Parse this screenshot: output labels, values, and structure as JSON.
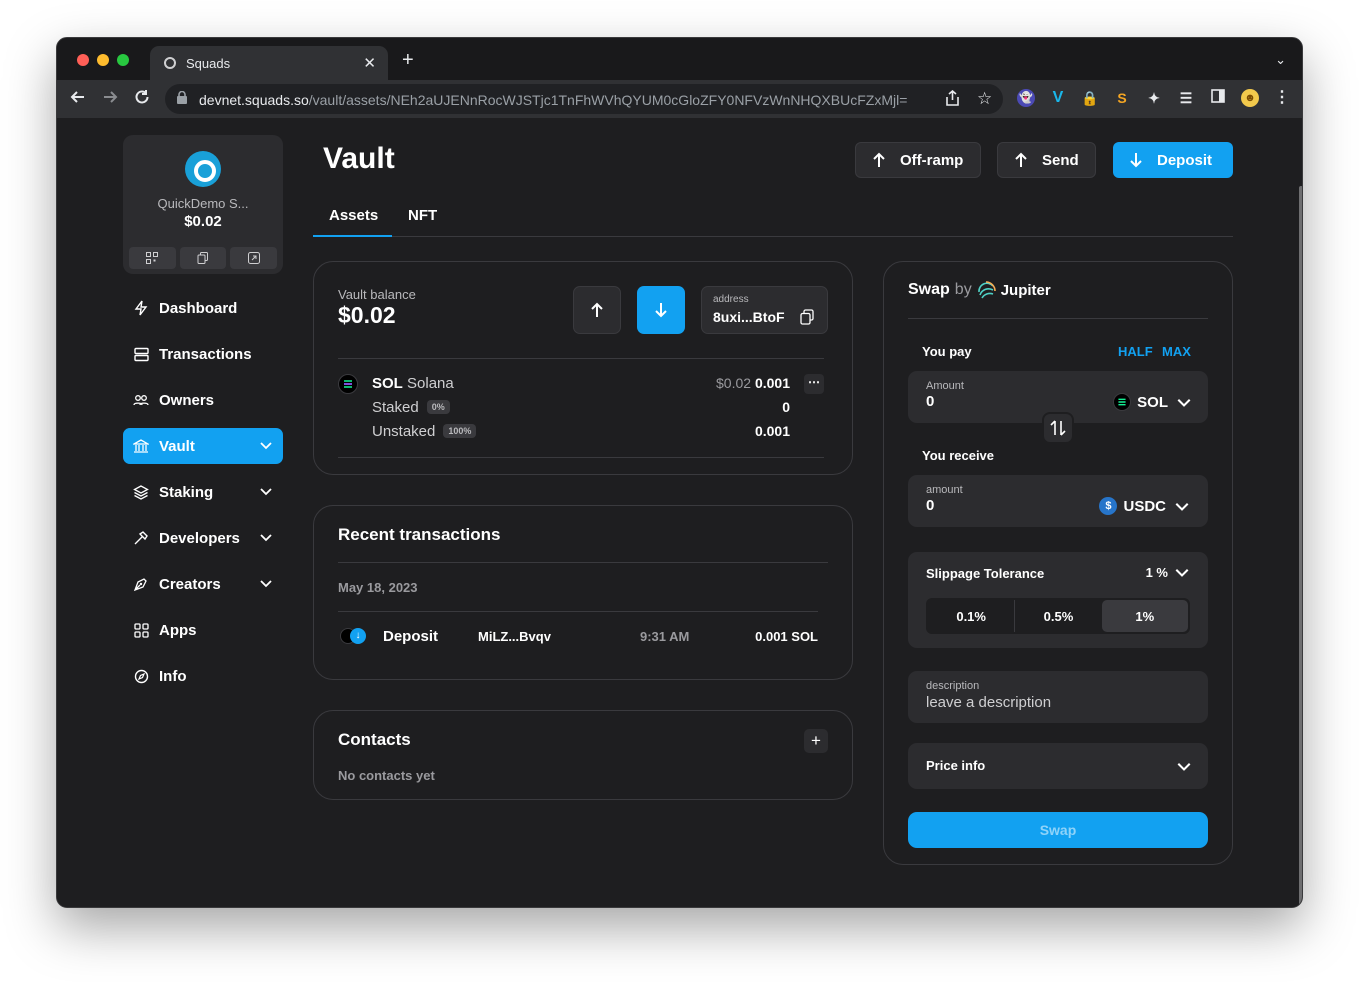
{
  "browser": {
    "tab_title": "Squads",
    "url_host": "devnet.squads.so",
    "url_path": "/vault/assets/NEh2aUJENnRocWJSTjc1TnFhWVhQYUM0cGloZFY0NFVzWnNHQXBUcFZxMjl="
  },
  "wallet": {
    "name": "QuickDemo S...",
    "balance": "$0.02"
  },
  "sidebar": {
    "items": [
      {
        "label": "Dashboard",
        "icon": "bolt-icon"
      },
      {
        "label": "Transactions",
        "icon": "server-icon"
      },
      {
        "label": "Owners",
        "icon": "users-icon"
      },
      {
        "label": "Vault",
        "icon": "bank-icon",
        "active": true
      },
      {
        "label": "Staking",
        "icon": "layers-icon"
      },
      {
        "label": "Developers",
        "icon": "hammer-icon"
      },
      {
        "label": "Creators",
        "icon": "pen-nib-icon"
      },
      {
        "label": "Apps",
        "icon": "grid-icon"
      },
      {
        "label": "Info",
        "icon": "compass-icon"
      }
    ]
  },
  "header": {
    "title": "Vault",
    "offramp_label": "Off-ramp",
    "send_label": "Send",
    "deposit_label": "Deposit"
  },
  "tabs": {
    "assets": "Assets",
    "nft": "NFT"
  },
  "vault_card": {
    "balance_label": "Vault balance",
    "balance_value": "$0.02",
    "address_label": "address",
    "address_value": "8uxi...BtoF",
    "asset": {
      "symbol": "SOL",
      "name": "Solana",
      "usd_value": "$0.02",
      "amount": "0.001",
      "staked_label": "Staked",
      "staked_pct": "0%",
      "staked_amount": "0",
      "unstaked_label": "Unstaked",
      "unstaked_pct": "100%",
      "unstaked_amount": "0.001"
    }
  },
  "recent": {
    "title": "Recent transactions",
    "date": "May 18, 2023",
    "rows": [
      {
        "type": "Deposit",
        "address": "MiLZ...Bvqv",
        "time": "9:31 AM",
        "amount": "0.001 SOL"
      }
    ]
  },
  "contacts": {
    "title": "Contacts",
    "empty": "No contacts yet"
  },
  "swap": {
    "title_prefix": "Swap",
    "title_by": "by",
    "provider": "Jupiter",
    "you_pay": "You pay",
    "half": "HALF",
    "max": "MAX",
    "pay_label": "Amount",
    "pay_value": "0",
    "pay_token": "SOL",
    "you_receive": "You receive",
    "receive_label": "amount",
    "receive_value": "0",
    "receive_token": "USDC",
    "slippage_label": "Slippage Tolerance",
    "slippage_value": "1 %",
    "slippage_options": [
      "0.1%",
      "0.5%",
      "1%"
    ],
    "slippage_selected": "1%",
    "description_label": "description",
    "description_placeholder": "leave a description",
    "price_info": "Price info",
    "swap_button": "Swap"
  },
  "colors": {
    "accent": "#12a1f1",
    "background": "#1e1e20",
    "panel": "#2c2c2f"
  }
}
